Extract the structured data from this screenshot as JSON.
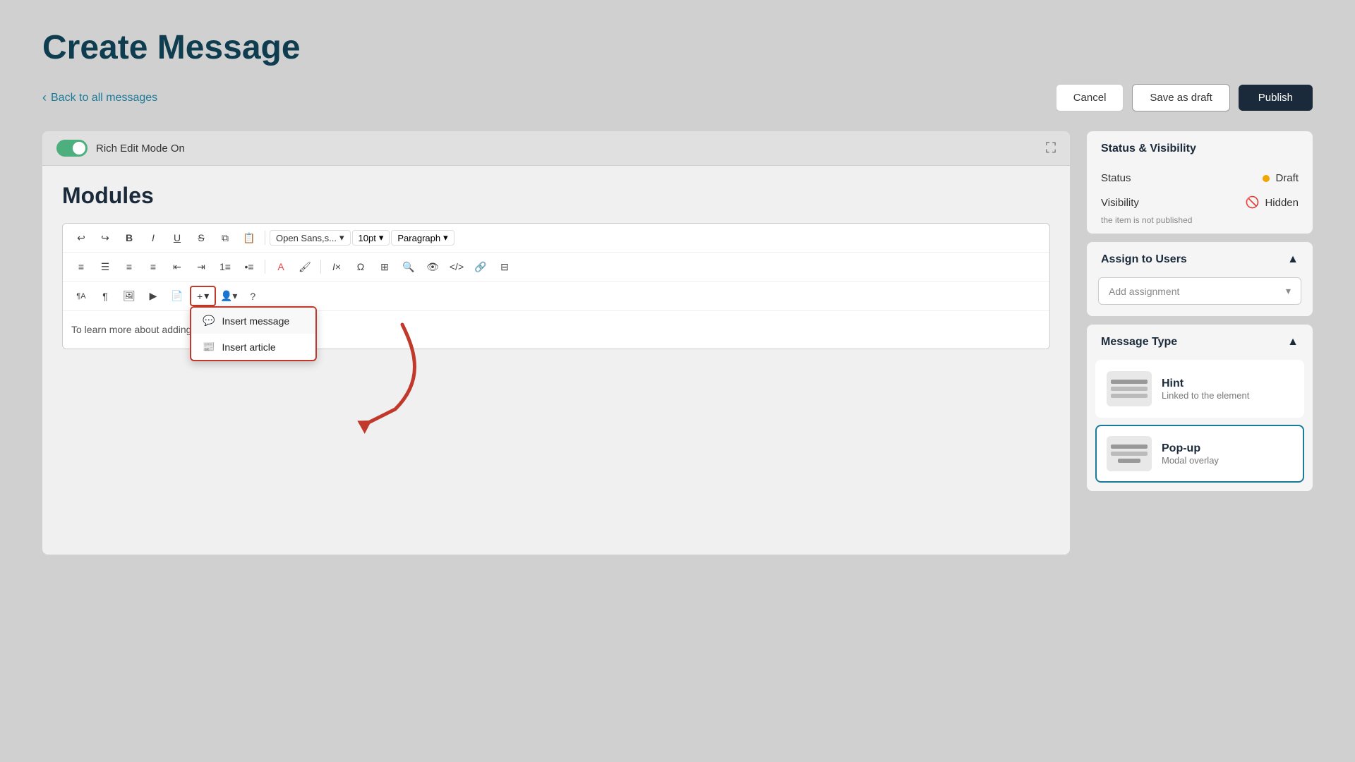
{
  "page": {
    "title": "Create Message",
    "back_link": "Back to all messages"
  },
  "toolbar": {
    "cancel_label": "Cancel",
    "save_draft_label": "Save as draft",
    "publish_label": "Publish"
  },
  "rich_edit": {
    "label": "Rich Edit Mode On",
    "toggle_state": "on"
  },
  "editor": {
    "section_title": "Modules",
    "font_name": "Open Sans,s...",
    "font_size": "10pt",
    "paragraph": "Paragraph",
    "body_text": "To learn more about adding m...ent ...lease Update."
  },
  "dropdown_menu": {
    "items": [
      {
        "id": "insert-message",
        "label": "Insert message",
        "icon": "message-icon"
      },
      {
        "id": "insert-article",
        "label": "Insert article",
        "icon": "article-icon"
      }
    ]
  },
  "sidebar": {
    "status_visibility": {
      "section_title": "Status & Visibility",
      "status_label": "Status",
      "status_value": "Draft",
      "visibility_label": "Visibility",
      "visibility_value": "Hidden",
      "visibility_hint": "the item is not published"
    },
    "assign_users": {
      "section_title": "Assign to Users",
      "add_assignment_placeholder": "Add assignment"
    },
    "message_type": {
      "section_title": "Message Type",
      "types": [
        {
          "id": "hint",
          "label": "Hint",
          "description": "Linked to the element",
          "selected": false
        },
        {
          "id": "popup",
          "label": "Pop-up",
          "description": "Modal overlay",
          "selected": true
        }
      ]
    }
  }
}
